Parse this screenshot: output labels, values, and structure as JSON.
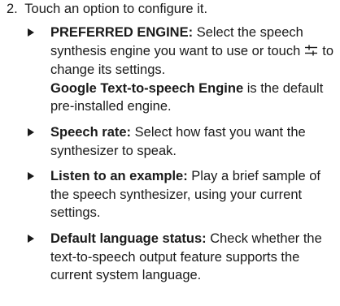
{
  "step": {
    "number": "2.",
    "text": "Touch an option to configure it."
  },
  "items": [
    {
      "term": "PREFERRED ENGINE:",
      "desc_before_icon": " Select the speech synthesis engine you want to use or touch",
      "icon": "settings-sliders-icon",
      "desc_after_icon": "to change its settings.",
      "bold_tail": "Google Text-to-speech Engine",
      "tail_rest": " is the default pre-installed engine."
    },
    {
      "term": "Speech rate:",
      "desc": " Select how fast you want the synthesizer to speak."
    },
    {
      "term": "Listen to an example:",
      "desc": " Play a brief sample of the speech synthesizer, using your current settings."
    },
    {
      "term": "Default language status:",
      "desc": " Check whether the text-to-speech output feature supports the current system language."
    }
  ]
}
